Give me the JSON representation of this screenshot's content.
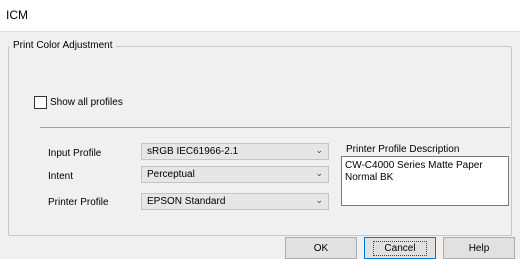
{
  "window": {
    "title": "ICM"
  },
  "group": {
    "label": "Print Color Adjustment"
  },
  "show_all_profiles": {
    "label": "Show all profiles",
    "checked": false
  },
  "fields": {
    "input_profile": {
      "label": "Input Profile",
      "value": "sRGB IEC61966-2.1"
    },
    "intent": {
      "label": "Intent",
      "value": "Perceptual"
    },
    "printer_profile": {
      "label": "Printer Profile",
      "value": "EPSON Standard"
    }
  },
  "description": {
    "label": "Printer Profile Description",
    "text": "CW-C4000 Series Matte Paper\nNormal BK"
  },
  "buttons": {
    "ok": "OK",
    "cancel": "Cancel",
    "help": "Help"
  },
  "icons": {
    "dropdown": "chevron-down-icon"
  }
}
